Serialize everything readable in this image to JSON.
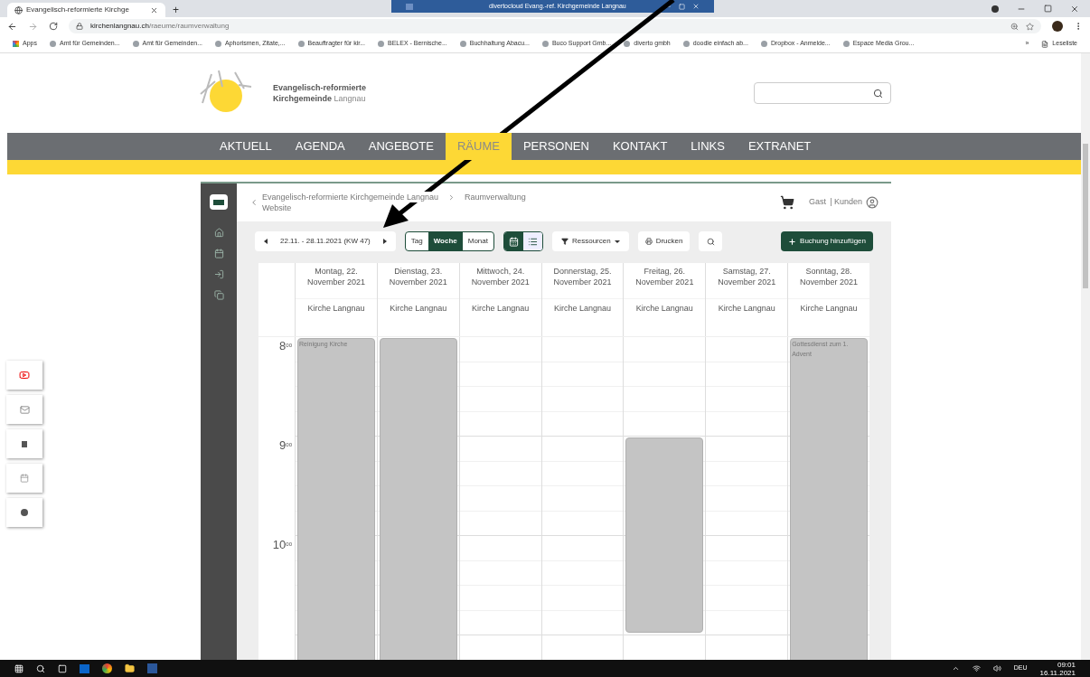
{
  "browser": {
    "tab_title": "Evangelisch-reformierte Kirchge",
    "new_tab": "+",
    "url": "kirchenlangnau.ch**/raeume/raumverwaltung**",
    "bookmarks": [
      "Apps",
      "Amt für Gemeinden...",
      "Amt für Gemeinden...",
      "Aphorismen, Zitate,...",
      "Beauftragter für kir...",
      "BELEX - Bernische...",
      "Buchhaltung Abacu...",
      "Buco Support Gmb...",
      "diverto gmbh",
      "doodle einfach ab...",
      "Dropbox - Anmelde...",
      "Espace Media Grou..."
    ],
    "overflow": "»",
    "reading_list": "Leseliste"
  },
  "remote_bar": {
    "title": "divertocloud Evang.-ref. Kirchgemeinde Langnau"
  },
  "site": {
    "org_line1": "Evangelisch-reformierte",
    "org_line2": "Kirchgemeinde **Langnau**",
    "nav": [
      {
        "label": "AKTUELL",
        "selected": false
      },
      {
        "label": "AGENDA",
        "selected": false
      },
      {
        "label": "ANGEBOTE",
        "selected": false
      },
      {
        "label": "RÄUME",
        "selected": true
      },
      {
        "label": "PERSONEN",
        "selected": false
      },
      {
        "label": "KONTAKT",
        "selected": false
      },
      {
        "label": "LINKS",
        "selected": false
      },
      {
        "label": "EXTRANET",
        "selected": false
      }
    ]
  },
  "app": {
    "breadcrumb": [
      "Evangelisch-reformierte Kirchgemeinde Langnau",
      "Raumverwaltung"
    ],
    "breadcrumb_sub": "Website",
    "user": "Gast",
    "user_role": "| Kunden",
    "date_range": "22.11. - 28.11.2021 (KW 47)",
    "views": [
      {
        "label": "Tag",
        "selected": false
      },
      {
        "label": "Woche",
        "selected": true
      },
      {
        "label": "Monat",
        "selected": false
      }
    ],
    "display_modes": [
      {
        "kind": "calendar",
        "selected": true
      },
      {
        "kind": "list",
        "selected": false
      }
    ],
    "resources": "Ressourcen",
    "print": "Drucken",
    "add_booking": "Buchung hinzufügen"
  },
  "calendar": {
    "days": [
      {
        "day": "Montag, 22.",
        "month": "November 2021",
        "resource": "Kirche Langnau",
        "events": [
          {
            "kind": "from_8",
            "title": "Reinigung Kirche"
          }
        ]
      },
      {
        "day": "Dienstag, 23.",
        "month": "November 2021",
        "resource": "Kirche Langnau",
        "events": [
          {
            "kind": "from_8"
          }
        ]
      },
      {
        "day": "Mittwoch, 24.",
        "month": "November 2021",
        "resource": "Kirche Langnau"
      },
      {
        "day": "Donnerstag, 25.",
        "month": "November 2021",
        "resource": "Kirche Langnau"
      },
      {
        "day": "Freitag, 26.",
        "month": "November 2021",
        "resource": "Kirche Langnau",
        "events": [
          {
            "kind": "from_9"
          }
        ]
      },
      {
        "day": "Samstag, 27.",
        "month": "November 2021",
        "resource": "Kirche Langnau"
      },
      {
        "day": "Sonntag, 28.",
        "month": "November 2021",
        "resource": "Kirche Langnau",
        "events": [
          {
            "kind": "from_8",
            "title": "Gottesdienst zum 1. Advent"
          }
        ]
      }
    ],
    "hours": [
      "8$^{00}$",
      "9$^{00}$",
      "10$^{00}$"
    ]
  },
  "taskbar": {
    "language": "DEU",
    "time": "09:01",
    "date": "16.11.2021"
  }
}
